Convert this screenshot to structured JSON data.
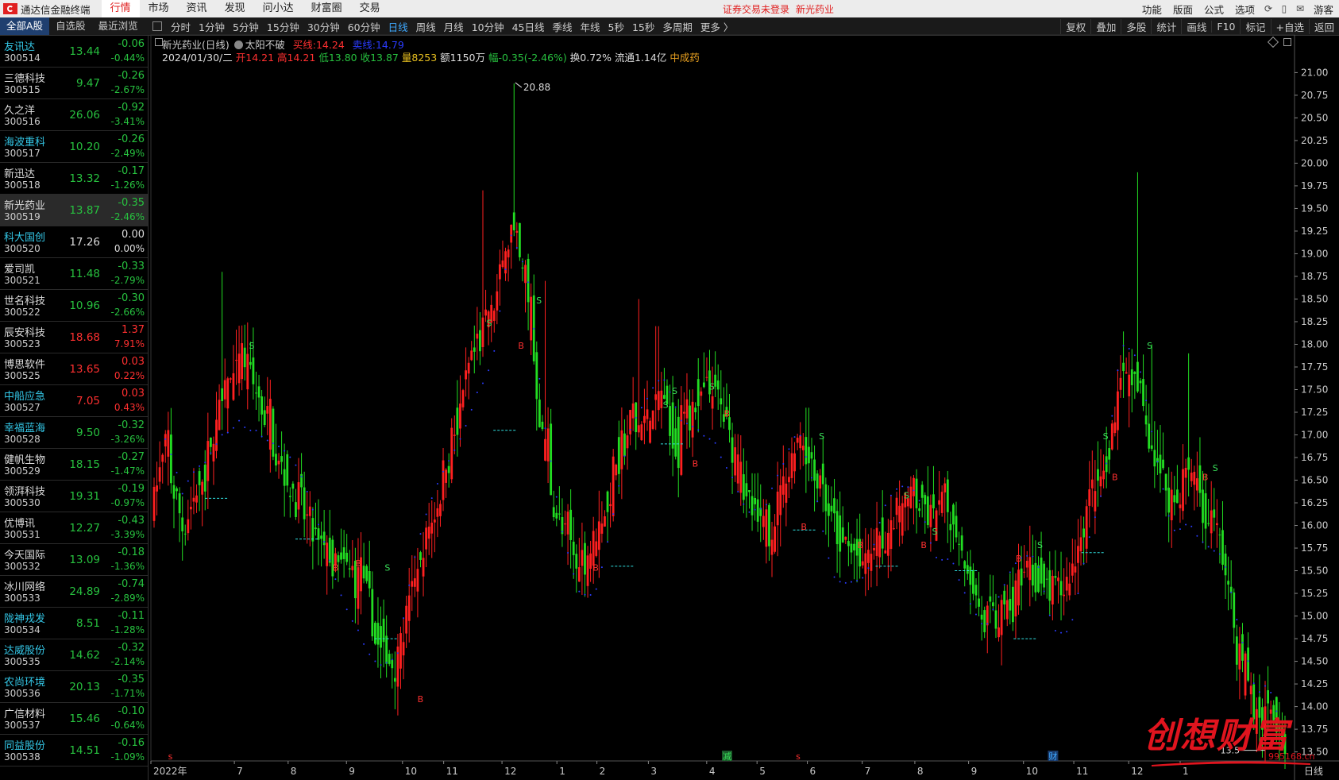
{
  "topbar": {
    "app_name": "通达信金融终端",
    "menus": [
      "行情",
      "市场",
      "资讯",
      "发现",
      "问小达",
      "财富圈",
      "交易"
    ],
    "active_menu": "行情",
    "notice_login": "证券交易未登录",
    "notice_stock": "新光药业",
    "right_menus": [
      "功能",
      "版面",
      "公式",
      "选项"
    ],
    "guest": "游客"
  },
  "secbar": {
    "tabs": [
      "全部A股",
      "自选股",
      "最近浏览"
    ],
    "active_tab": "全部A股",
    "periods": [
      "分时",
      "1分钟",
      "5分钟",
      "15分钟",
      "30分钟",
      "60分钟",
      "日线",
      "周线",
      "月线",
      "10分钟",
      "45日线",
      "季线",
      "年线",
      "5秒",
      "15秒",
      "多周期",
      "更多 〉"
    ],
    "active_period": "日线",
    "tools": [
      "复权",
      "叠加",
      "多股",
      "统计",
      "画线",
      "F10",
      "标记",
      "+自选",
      "返回"
    ]
  },
  "stocks": [
    {
      "name": "友讯达",
      "code": "300514",
      "price": "13.44",
      "chg": "-0.06",
      "pct": "-0.44%",
      "dir": "dn",
      "cyan": true
    },
    {
      "name": "三德科技",
      "code": "300515",
      "price": "9.47",
      "chg": "-0.26",
      "pct": "-2.67%",
      "dir": "dn",
      "cyan": false
    },
    {
      "name": "久之洋",
      "code": "300516",
      "price": "26.06",
      "chg": "-0.92",
      "pct": "-3.41%",
      "dir": "dn",
      "cyan": false
    },
    {
      "name": "海波重科",
      "code": "300517",
      "price": "10.20",
      "chg": "-0.26",
      "pct": "-2.49%",
      "dir": "dn",
      "cyan": true
    },
    {
      "name": "新迅达",
      "code": "300518",
      "price": "13.32",
      "chg": "-0.17",
      "pct": "-1.26%",
      "dir": "dn",
      "cyan": false
    },
    {
      "name": "新光药业",
      "code": "300519",
      "price": "13.87",
      "chg": "-0.35",
      "pct": "-2.46%",
      "dir": "dn",
      "cyan": false,
      "sel": true
    },
    {
      "name": "科大国创",
      "code": "300520",
      "price": "17.26",
      "chg": "0.00",
      "pct": "0.00%",
      "dir": "flat",
      "cyan": true
    },
    {
      "name": "爱司凯",
      "code": "300521",
      "price": "11.48",
      "chg": "-0.33",
      "pct": "-2.79%",
      "dir": "dn",
      "cyan": false
    },
    {
      "name": "世名科技",
      "code": "300522",
      "price": "10.96",
      "chg": "-0.30",
      "pct": "-2.66%",
      "dir": "dn",
      "cyan": false
    },
    {
      "name": "辰安科技",
      "code": "300523",
      "price": "18.68",
      "chg": "1.37",
      "pct": "7.91%",
      "dir": "up",
      "cyan": false
    },
    {
      "name": "博思软件",
      "code": "300525",
      "price": "13.65",
      "chg": "0.03",
      "pct": "0.22%",
      "dir": "up",
      "cyan": false
    },
    {
      "name": "中船应急",
      "code": "300527",
      "price": "7.05",
      "chg": "0.03",
      "pct": "0.43%",
      "dir": "up",
      "cyan": true
    },
    {
      "name": "幸福蓝海",
      "code": "300528",
      "price": "9.50",
      "chg": "-0.32",
      "pct": "-3.26%",
      "dir": "dn",
      "cyan": true
    },
    {
      "name": "健帆生物",
      "code": "300529",
      "price": "18.15",
      "chg": "-0.27",
      "pct": "-1.47%",
      "dir": "dn",
      "cyan": false
    },
    {
      "name": "领湃科技",
      "code": "300530",
      "price": "19.31",
      "chg": "-0.19",
      "pct": "-0.97%",
      "dir": "dn",
      "cyan": false
    },
    {
      "name": "优博讯",
      "code": "300531",
      "price": "12.27",
      "chg": "-0.43",
      "pct": "-3.39%",
      "dir": "dn",
      "cyan": false
    },
    {
      "name": "今天国际",
      "code": "300532",
      "price": "13.09",
      "chg": "-0.18",
      "pct": "-1.36%",
      "dir": "dn",
      "cyan": false
    },
    {
      "name": "冰川网络",
      "code": "300533",
      "price": "24.89",
      "chg": "-0.74",
      "pct": "-2.89%",
      "dir": "dn",
      "cyan": false
    },
    {
      "name": "陇神戎发",
      "code": "300534",
      "price": "8.51",
      "chg": "-0.11",
      "pct": "-1.28%",
      "dir": "dn",
      "cyan": true
    },
    {
      "name": "达威股份",
      "code": "300535",
      "price": "14.62",
      "chg": "-0.32",
      "pct": "-2.14%",
      "dir": "dn",
      "cyan": true
    },
    {
      "name": "农尚环境",
      "code": "300536",
      "price": "20.13",
      "chg": "-0.35",
      "pct": "-1.71%",
      "dir": "dn",
      "cyan": true
    },
    {
      "name": "广信材料",
      "code": "300537",
      "price": "15.46",
      "chg": "-0.10",
      "pct": "-0.64%",
      "dir": "dn",
      "cyan": false
    },
    {
      "name": "同益股份",
      "code": "300538",
      "price": "14.51",
      "chg": "-0.16",
      "pct": "-1.09%",
      "dir": "dn",
      "cyan": true
    }
  ],
  "chart_header": {
    "stock_title": "新光药业(日线)",
    "indicator": "太阳不破",
    "buy_label": "买线:",
    "buy_value": "14.24",
    "sell_label": "卖线:",
    "sell_value": "14.79",
    "date": "2024/01/30/二",
    "open": "开14.21",
    "high": "高14.21",
    "low": "低13.80",
    "close": "收13.87",
    "volume": "量8253",
    "amount": "额1150万",
    "change": "幅-0.35(-2.46%)",
    "turnover": "换0.72%",
    "float": "流通1.14亿",
    "sector": "中成药"
  },
  "chart_data": {
    "type": "candlestick",
    "period": "日线",
    "y_ticks": [
      21.0,
      20.75,
      20.5,
      20.25,
      20.0,
      19.75,
      19.5,
      19.25,
      19.0,
      18.75,
      18.5,
      18.25,
      18.0,
      17.75,
      17.5,
      17.25,
      17.0,
      16.75,
      16.5,
      16.25,
      16.0,
      15.75,
      15.5,
      15.25,
      15.0,
      14.75,
      14.5,
      14.25,
      14.0,
      13.75,
      13.5
    ],
    "ylim": [
      13.4,
      21.1
    ],
    "x_labels": [
      {
        "label": "2022年",
        "pos": 0.0
      },
      {
        "label": "7",
        "pos": 0.073
      },
      {
        "label": "8",
        "pos": 0.12
      },
      {
        "label": "9",
        "pos": 0.171
      },
      {
        "label": "10",
        "pos": 0.22
      },
      {
        "label": "11",
        "pos": 0.256
      },
      {
        "label": "12",
        "pos": 0.307
      },
      {
        "label": "1",
        "pos": 0.355
      },
      {
        "label": "2",
        "pos": 0.39
      },
      {
        "label": "3",
        "pos": 0.435
      },
      {
        "label": "4",
        "pos": 0.486
      },
      {
        "label": "5",
        "pos": 0.53
      },
      {
        "label": "6",
        "pos": 0.574
      },
      {
        "label": "7",
        "pos": 0.622
      },
      {
        "label": "8",
        "pos": 0.668
      },
      {
        "label": "9",
        "pos": 0.715
      },
      {
        "label": "10",
        "pos": 0.763
      },
      {
        "label": "11",
        "pos": 0.807
      },
      {
        "label": "12",
        "pos": 0.855
      },
      {
        "label": "1",
        "pos": 0.9
      }
    ],
    "bottom_right_label": "日线",
    "max_label": "20.88",
    "min_label": "13.5",
    "bottom_marks": [
      {
        "text": "s",
        "pos": 0.015,
        "color": "#ff3030"
      },
      {
        "text": "减",
        "pos": 0.5,
        "color": "#3ae05a"
      },
      {
        "text": "s",
        "pos": 0.564,
        "color": "#ff3030"
      },
      {
        "text": "财",
        "pos": 0.785,
        "color": "#3fa9ff"
      }
    ],
    "trend_anchors": [
      {
        "t": 0.0,
        "p": 16.3
      },
      {
        "t": 0.01,
        "p": 16.8
      },
      {
        "t": 0.025,
        "p": 16.0
      },
      {
        "t": 0.045,
        "p": 16.6
      },
      {
        "t": 0.06,
        "p": 17.3
      },
      {
        "t": 0.075,
        "p": 17.7
      },
      {
        "t": 0.09,
        "p": 17.5
      },
      {
        "t": 0.105,
        "p": 17.0
      },
      {
        "t": 0.12,
        "p": 16.5
      },
      {
        "t": 0.14,
        "p": 15.9
      },
      {
        "t": 0.16,
        "p": 15.6
      },
      {
        "t": 0.18,
        "p": 15.4
      },
      {
        "t": 0.2,
        "p": 14.8
      },
      {
        "t": 0.215,
        "p": 14.5
      },
      {
        "t": 0.228,
        "p": 15.2
      },
      {
        "t": 0.245,
        "p": 16.0
      },
      {
        "t": 0.265,
        "p": 17.0
      },
      {
        "t": 0.285,
        "p": 18.0
      },
      {
        "t": 0.3,
        "p": 18.3
      },
      {
        "t": 0.315,
        "p": 19.3
      },
      {
        "t": 0.33,
        "p": 18.5
      },
      {
        "t": 0.345,
        "p": 16.8
      },
      {
        "t": 0.36,
        "p": 15.9
      },
      {
        "t": 0.375,
        "p": 15.6
      },
      {
        "t": 0.39,
        "p": 15.8
      },
      {
        "t": 0.405,
        "p": 16.5
      },
      {
        "t": 0.42,
        "p": 17.1
      },
      {
        "t": 0.435,
        "p": 17.1
      },
      {
        "t": 0.45,
        "p": 17.3
      },
      {
        "t": 0.465,
        "p": 17.1
      },
      {
        "t": 0.48,
        "p": 17.4
      },
      {
        "t": 0.495,
        "p": 17.5
      },
      {
        "t": 0.51,
        "p": 17.0
      },
      {
        "t": 0.525,
        "p": 16.2
      },
      {
        "t": 0.54,
        "p": 15.9
      },
      {
        "t": 0.555,
        "p": 16.3
      },
      {
        "t": 0.57,
        "p": 17.0
      },
      {
        "t": 0.585,
        "p": 16.7
      },
      {
        "t": 0.6,
        "p": 16.0
      },
      {
        "t": 0.615,
        "p": 15.8
      },
      {
        "t": 0.63,
        "p": 15.5
      },
      {
        "t": 0.645,
        "p": 15.9
      },
      {
        "t": 0.66,
        "p": 16.1
      },
      {
        "t": 0.675,
        "p": 16.3
      },
      {
        "t": 0.69,
        "p": 16.0
      },
      {
        "t": 0.705,
        "p": 16.2
      },
      {
        "t": 0.72,
        "p": 15.6
      },
      {
        "t": 0.735,
        "p": 14.9
      },
      {
        "t": 0.75,
        "p": 15.0
      },
      {
        "t": 0.765,
        "p": 15.3
      },
      {
        "t": 0.78,
        "p": 15.6
      },
      {
        "t": 0.795,
        "p": 15.2
      },
      {
        "t": 0.81,
        "p": 15.4
      },
      {
        "t": 0.825,
        "p": 16.2
      },
      {
        "t": 0.84,
        "p": 16.5
      },
      {
        "t": 0.855,
        "p": 17.7
      },
      {
        "t": 0.87,
        "p": 17.5
      },
      {
        "t": 0.885,
        "p": 16.8
      },
      {
        "t": 0.9,
        "p": 16.3
      },
      {
        "t": 0.915,
        "p": 16.6
      },
      {
        "t": 0.93,
        "p": 16.2
      },
      {
        "t": 0.945,
        "p": 15.7
      },
      {
        "t": 0.96,
        "p": 14.5
      },
      {
        "t": 0.975,
        "p": 13.8
      },
      {
        "t": 0.985,
        "p": 14.1
      },
      {
        "t": 1.0,
        "p": 13.87
      }
    ],
    "spikes": [
      {
        "t": 0.06,
        "p": 18.8
      },
      {
        "t": 0.29,
        "p": 19.7
      },
      {
        "t": 0.318,
        "p": 20.88
      },
      {
        "t": 0.345,
        "p": 18.7
      },
      {
        "t": 0.428,
        "p": 18.5
      },
      {
        "t": 0.445,
        "p": 18.2
      },
      {
        "t": 0.578,
        "p": 17.3
      },
      {
        "t": 0.87,
        "p": 19.9
      },
      {
        "t": 0.883,
        "p": 18.0
      },
      {
        "t": 0.915,
        "p": 17.9
      }
    ],
    "signals": [
      {
        "text": "S",
        "t": 0.086,
        "p": 17.95,
        "color": "#3ae05a"
      },
      {
        "text": "B",
        "t": 0.16,
        "p": 15.5,
        "color": "#ff3030"
      },
      {
        "text": "B",
        "t": 0.18,
        "p": 15.55,
        "color": "#ff3030"
      },
      {
        "text": "S",
        "t": 0.206,
        "p": 15.5,
        "color": "#3ae05a"
      },
      {
        "text": "B",
        "t": 0.235,
        "p": 14.05,
        "color": "#ff3030"
      },
      {
        "text": "S",
        "t": 0.296,
        "p": 18.2,
        "color": "#3ae05a"
      },
      {
        "text": "B",
        "t": 0.324,
        "p": 17.95,
        "color": "#ff3030"
      },
      {
        "text": "S",
        "t": 0.34,
        "p": 18.45,
        "color": "#3ae05a"
      },
      {
        "text": "B",
        "t": 0.39,
        "p": 15.5,
        "color": "#ff3030"
      },
      {
        "text": "S",
        "t": 0.452,
        "p": 17.3,
        "color": "#3ae05a"
      },
      {
        "text": "S",
        "t": 0.46,
        "p": 17.45,
        "color": "#3ae05a"
      },
      {
        "text": "B",
        "t": 0.478,
        "p": 16.65,
        "color": "#ff3030"
      },
      {
        "text": "S",
        "t": 0.493,
        "p": 17.5,
        "color": "#3ae05a"
      },
      {
        "text": "B",
        "t": 0.506,
        "p": 17.2,
        "color": "#ff3030"
      },
      {
        "text": "B",
        "t": 0.574,
        "p": 15.95,
        "color": "#ff3030"
      },
      {
        "text": "S",
        "t": 0.59,
        "p": 16.95,
        "color": "#3ae05a"
      },
      {
        "text": "B",
        "t": 0.624,
        "p": 15.75,
        "color": "#ff3030"
      },
      {
        "text": "S",
        "t": 0.665,
        "p": 16.3,
        "color": "#3ae05a"
      },
      {
        "text": "B",
        "t": 0.68,
        "p": 15.75,
        "color": "#ff3030"
      },
      {
        "text": "S",
        "t": 0.69,
        "p": 15.9,
        "color": "#3ae05a"
      },
      {
        "text": "B",
        "t": 0.764,
        "p": 15.6,
        "color": "#ff3030"
      },
      {
        "text": "S",
        "t": 0.783,
        "p": 15.75,
        "color": "#3ae05a"
      },
      {
        "text": "S",
        "t": 0.841,
        "p": 16.95,
        "color": "#3ae05a"
      },
      {
        "text": "B",
        "t": 0.849,
        "p": 16.5,
        "color": "#ff3030"
      },
      {
        "text": "S",
        "t": 0.88,
        "p": 17.95,
        "color": "#3ae05a"
      },
      {
        "text": "B",
        "t": 0.929,
        "p": 16.5,
        "color": "#ff3030"
      },
      {
        "text": "S",
        "t": 0.938,
        "p": 16.6,
        "color": "#3ae05a"
      }
    ],
    "support_lines": [
      {
        "t": 0.045,
        "p": 16.3
      },
      {
        "t": 0.125,
        "p": 15.85
      },
      {
        "t": 0.195,
        "p": 14.75
      },
      {
        "t": 0.3,
        "p": 17.05
      },
      {
        "t": 0.404,
        "p": 15.55
      },
      {
        "t": 0.448,
        "p": 16.9
      },
      {
        "t": 0.565,
        "p": 15.95
      },
      {
        "t": 0.638,
        "p": 15.55
      },
      {
        "t": 0.708,
        "p": 15.5
      },
      {
        "t": 0.76,
        "p": 14.75
      },
      {
        "t": 0.82,
        "p": 15.7
      }
    ]
  },
  "watermark": {
    "text": "创想财富",
    "url": "995168.cn"
  },
  "colors": {
    "up": "#ff3030",
    "down": "#27c13f",
    "accent": "#3fa9ff",
    "trail": "#2a3cff"
  }
}
